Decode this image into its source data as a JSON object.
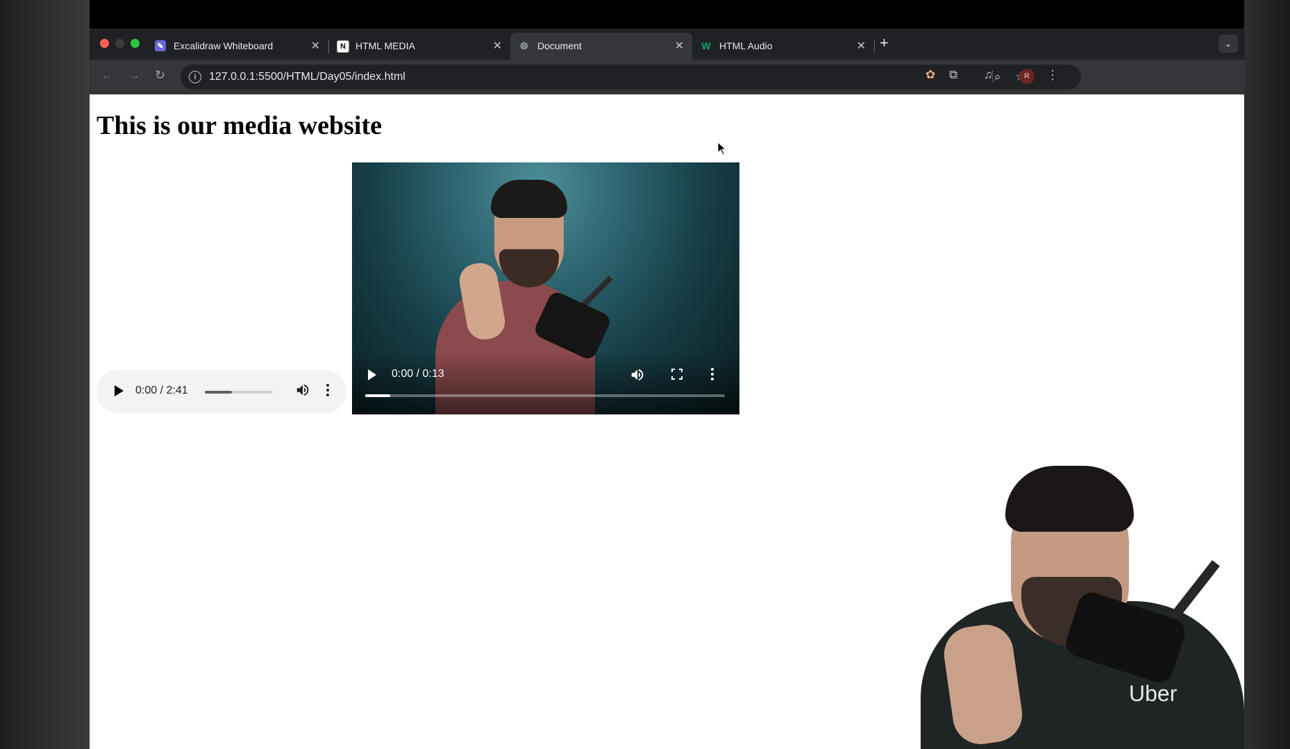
{
  "browser": {
    "tabs": [
      {
        "label": "Excalidraw Whiteboard",
        "icon": "excalidraw-icon",
        "color": "#6965db",
        "active": false
      },
      {
        "label": "HTML MEDIA",
        "icon": "notion-icon",
        "color": "#ffffff",
        "active": false
      },
      {
        "label": "Document",
        "icon": "globe-icon",
        "color": "#9aa0a6",
        "active": true
      },
      {
        "label": "HTML Audio",
        "icon": "w3schools-icon",
        "color": "#04aa6d",
        "active": false
      }
    ],
    "close_glyph": "✕",
    "new_tab_glyph": "+",
    "url": "127.0.0.1:5500/HTML/Day05/index.html",
    "profile_initial": "R"
  },
  "page": {
    "heading": "This is our media website",
    "audio": {
      "time": "0:00 / 2:41",
      "volume_level": 0.4
    },
    "video": {
      "time": "0:00 / 0:13",
      "progress": 0.07
    }
  },
  "presenter": {
    "shirt_text": "Uber"
  }
}
